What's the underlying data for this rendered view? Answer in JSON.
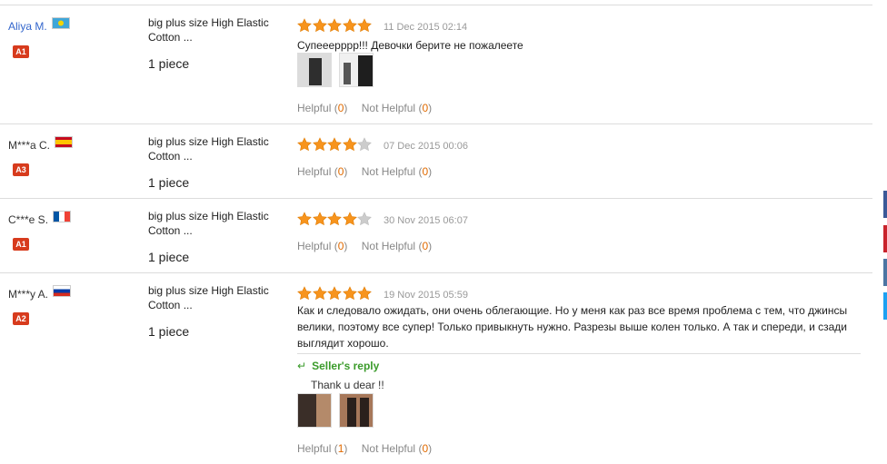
{
  "reviews": [
    {
      "user": "Aliya M.",
      "flag": "kz",
      "level": "A1",
      "product": "big plus size High Elastic Cotton ...",
      "quantity": "1 piece",
      "rating": 5,
      "date": "11 Dec 2015 02:14",
      "text": "Супееерррр!!! Девочки берите не пожалеете",
      "helpful_label": "Helpful",
      "helpful_count": "0",
      "not_helpful_label": "Not Helpful",
      "not_helpful_count": "0"
    },
    {
      "user": "M***a C.",
      "flag": "es",
      "level": "A3",
      "product": "big plus size High Elastic Cotton ...",
      "quantity": "1 piece",
      "rating": 4,
      "date": "07 Dec 2015 00:06",
      "helpful_label": "Helpful",
      "helpful_count": "0",
      "not_helpful_label": "Not Helpful",
      "not_helpful_count": "0"
    },
    {
      "user": "C***e S.",
      "flag": "fr",
      "level": "A1",
      "product": "big plus size High Elastic Cotton ...",
      "quantity": "1 piece",
      "rating": 4,
      "date": "30 Nov 2015 06:07",
      "helpful_label": "Helpful",
      "helpful_count": "0",
      "not_helpful_label": "Not Helpful",
      "not_helpful_count": "0"
    },
    {
      "user": "M***y A.",
      "flag": "ru",
      "level": "A2",
      "product": "big plus size High Elastic Cotton ...",
      "quantity": "1 piece",
      "rating": 5,
      "date": "19 Nov 2015 05:59",
      "text_lines": [
        "Как и следовало ожидать, они очень облегающие. Но у меня как раз все время проблема с тем, что джинсы",
        "велики, поэтому все супер! Только привыкнуть нужно. Разрезы выше колен только. А так и спереди, и сзади",
        "выглядит хорошо."
      ],
      "reply_title": "Seller's reply",
      "reply_text": "Thank u dear !!",
      "helpful_label": "Helpful",
      "helpful_count": "1",
      "not_helpful_label": "Not Helpful",
      "not_helpful_count": "0"
    }
  ],
  "colors": {
    "star": "#f7941d",
    "star_empty": "#cccccc",
    "level_badge": "#d73b1d",
    "link": "#3366cc",
    "reply": "#3b9b2b",
    "count": "#e06a00"
  }
}
